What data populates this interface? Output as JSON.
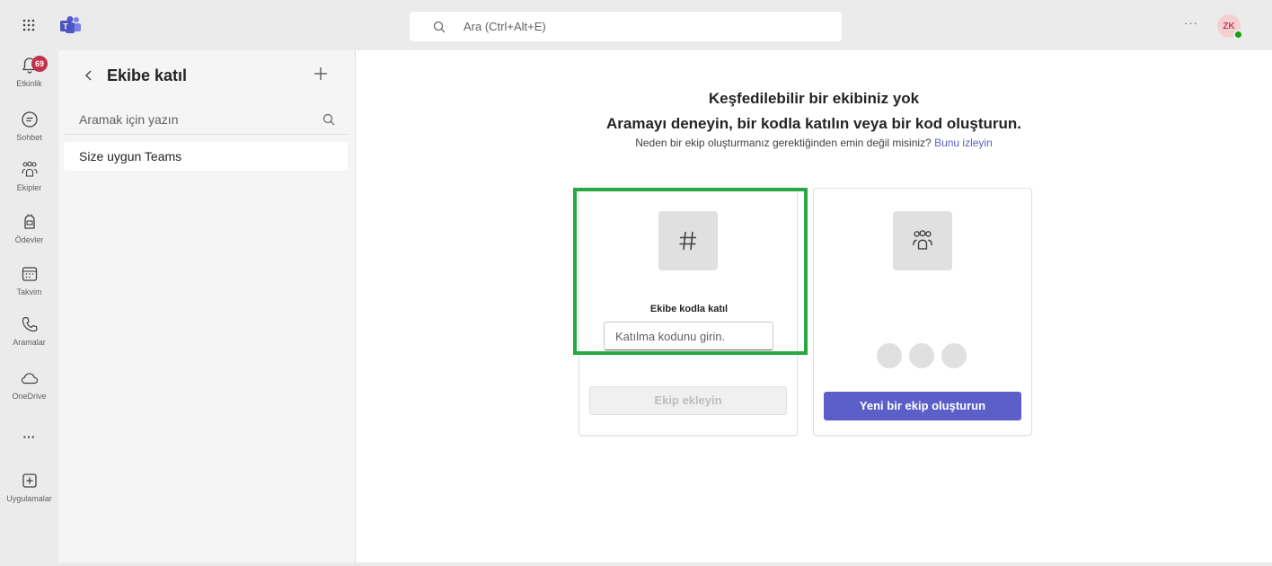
{
  "topbar": {
    "search_placeholder": "Ara (Ctrl+Alt+E)",
    "more_label": "···",
    "avatar_initials": "ZK"
  },
  "rail": {
    "items": [
      {
        "label": "Etkinlik",
        "icon": "bell-icon",
        "badge": "69"
      },
      {
        "label": "Sohbet",
        "icon": "chat-icon"
      },
      {
        "label": "Ekipler",
        "icon": "teams-people-icon"
      },
      {
        "label": "Ödevler",
        "icon": "assignments-icon"
      },
      {
        "label": "Takvim",
        "icon": "calendar-icon"
      },
      {
        "label": "Aramalar",
        "icon": "phone-icon"
      },
      {
        "label": "OneDrive",
        "icon": "cloud-icon"
      },
      {
        "label": "···",
        "icon": "more-icon"
      },
      {
        "label": "Uygulamalar",
        "icon": "add-app-icon"
      }
    ]
  },
  "leftpane": {
    "title": "Ekibe katıl",
    "search_placeholder": "Aramak için yazın",
    "list_item": "Size uygun Teams"
  },
  "main": {
    "heading1": "Keşfedilebilir bir ekibiniz yok",
    "heading2": "Aramayı deneyin, bir kodla katılın veya bir kod oluşturun.",
    "subline": "Neden bir ekip oluşturmanız gerektiğinden emin değil misiniz?",
    "subline_link": "Bunu izleyin",
    "join_card": {
      "label": "Ekibe kodla katıl",
      "input_placeholder": "Katılma kodunu girin.",
      "button_label": "Ekip ekleyin"
    },
    "create_card": {
      "button_label": "Yeni bir ekip oluşturun"
    }
  },
  "colors": {
    "accent": "#5b5fc7",
    "highlight": "#28a745",
    "badge": "#c4314b",
    "presence": "#13a10e"
  }
}
